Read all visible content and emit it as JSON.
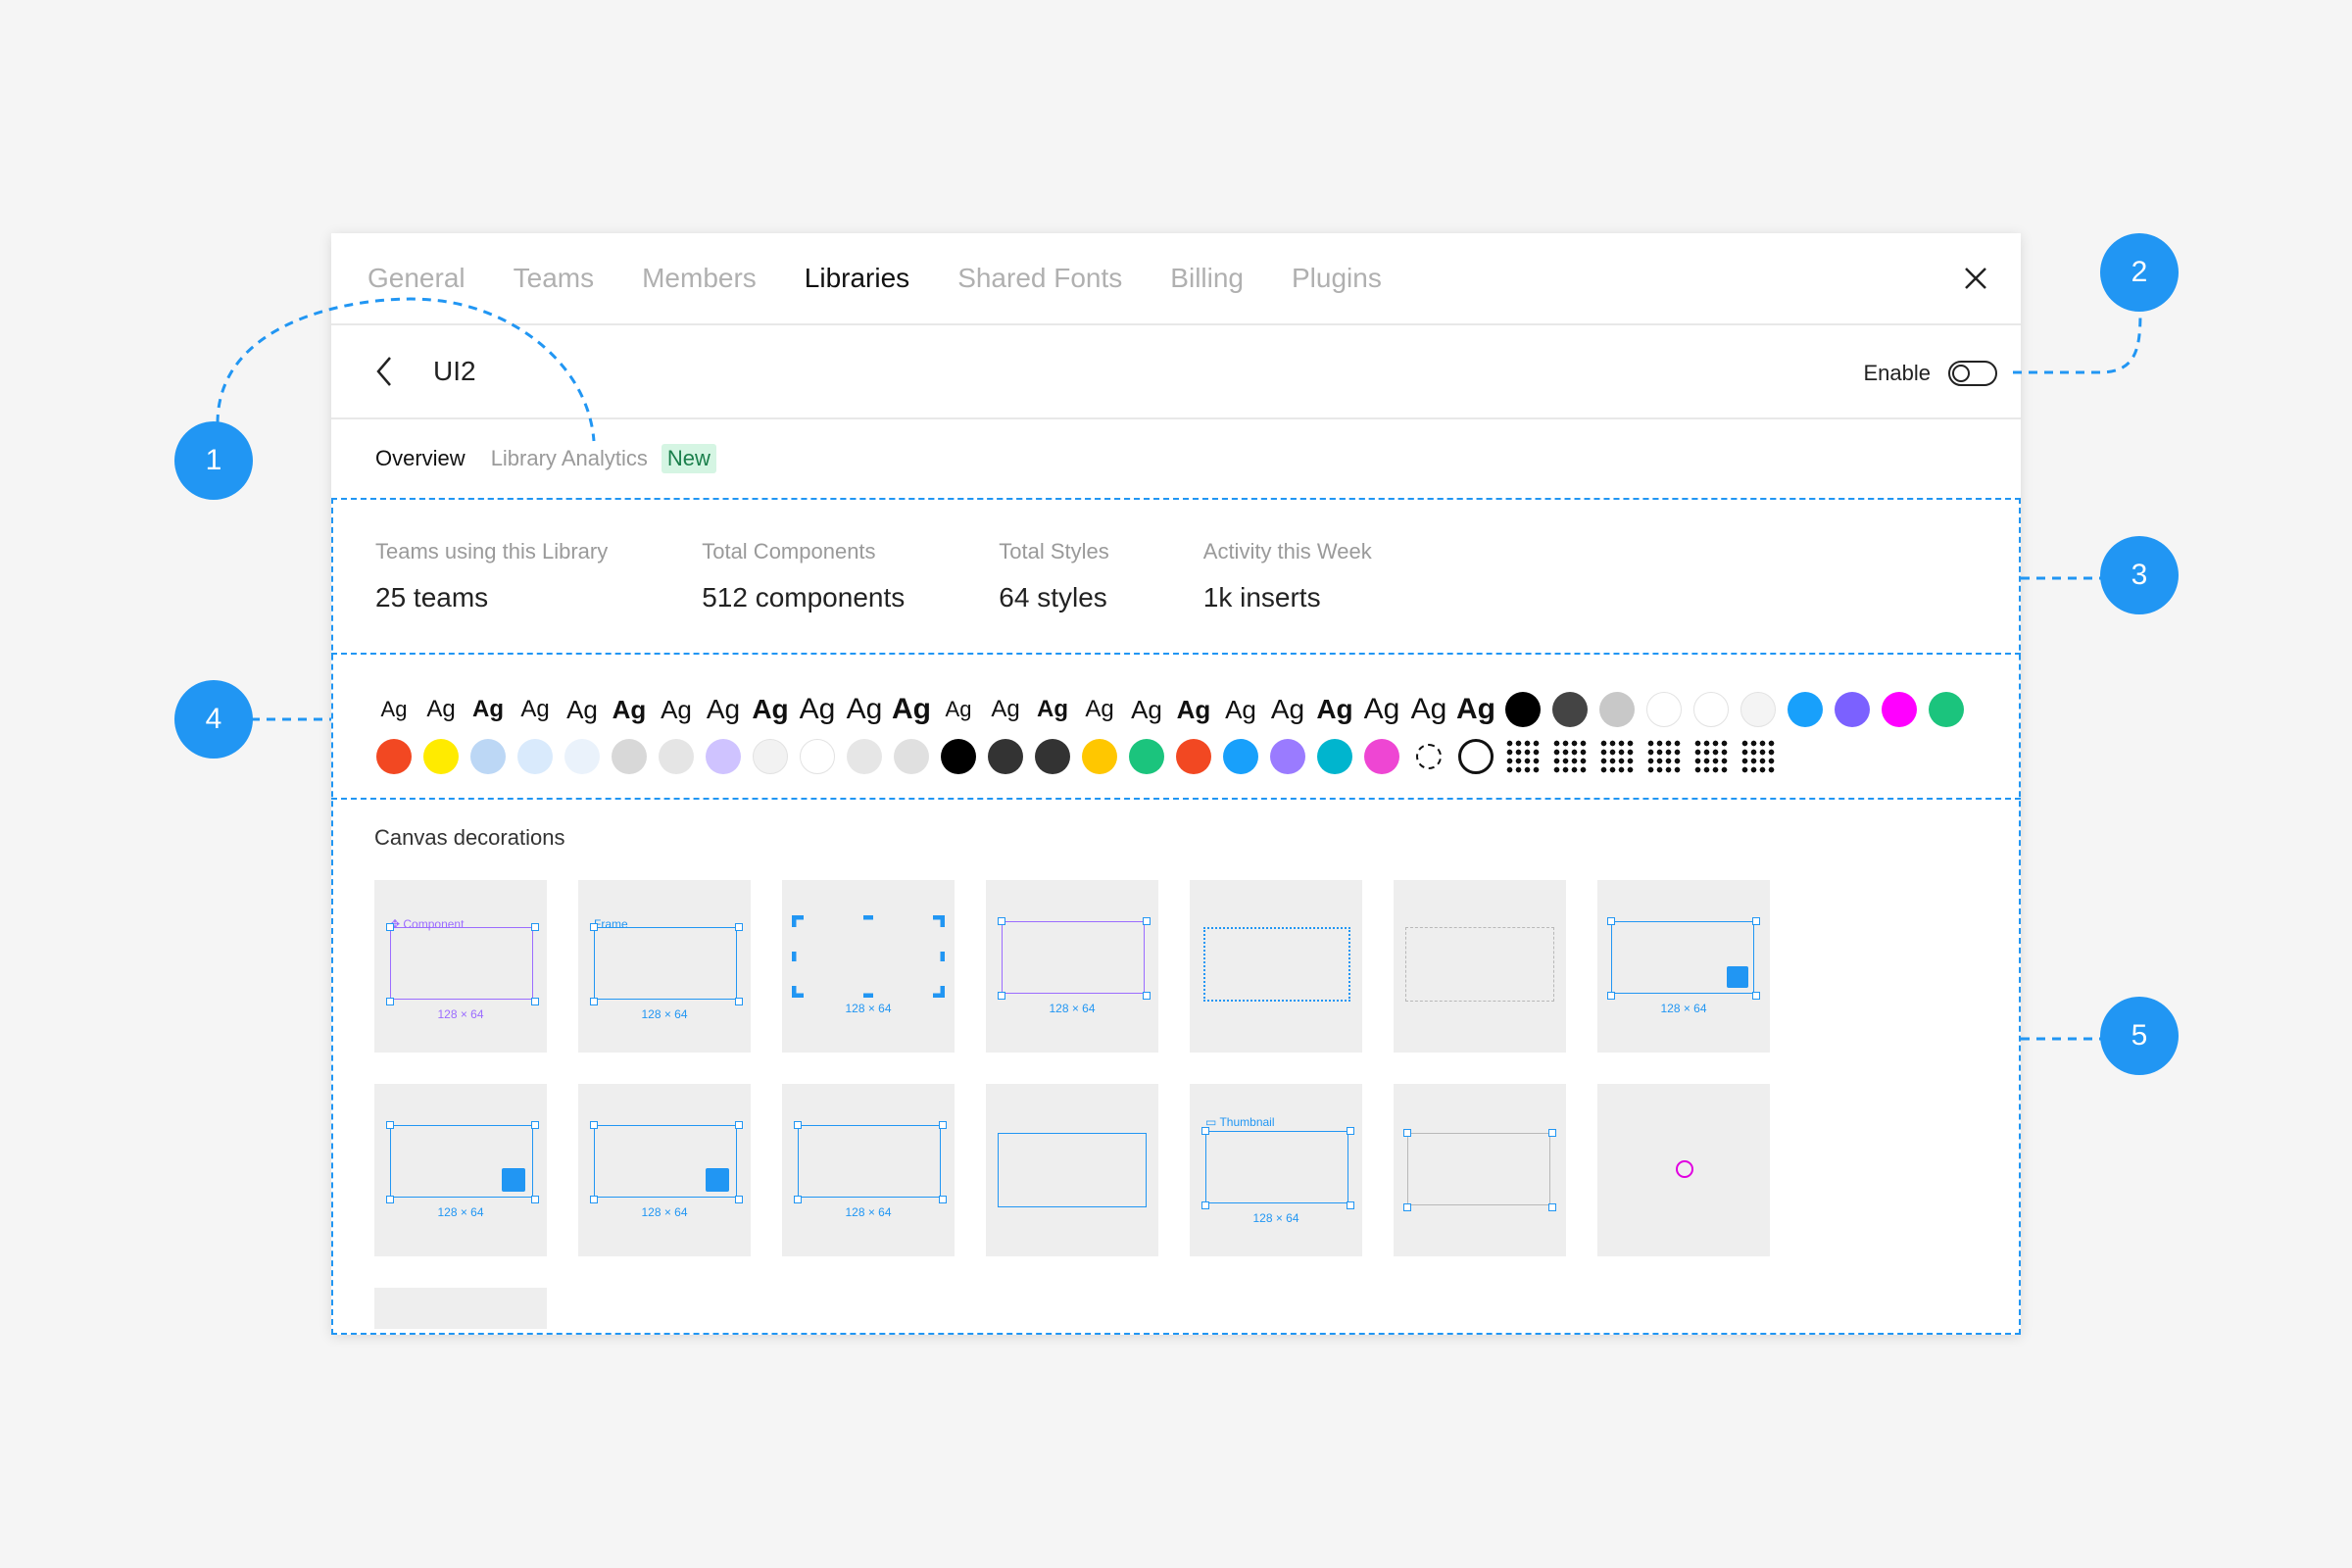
{
  "tabs": [
    "General",
    "Teams",
    "Members",
    "Libraries",
    "Shared Fonts",
    "Billing",
    "Plugins"
  ],
  "active_tab": "Libraries",
  "library": {
    "title": "UI2",
    "enable_label": "Enable",
    "enabled": false
  },
  "subtabs": {
    "overview": "Overview",
    "analytics": "Library Analytics",
    "badge": "New"
  },
  "stats": [
    {
      "label": "Teams using this Library",
      "value": "25 teams"
    },
    {
      "label": "Total Components",
      "value": "512 components"
    },
    {
      "label": "Total Styles",
      "value": "64 styles"
    },
    {
      "label": "Activity this Week",
      "value": "1k inserts"
    }
  ],
  "text_style_sample": "Ag",
  "text_styles_row1_count": 24,
  "colors_row1": [
    "#000000",
    "#444444",
    "#c8c8c8",
    "#ffffff",
    "#ffffff",
    "#f4f4f4",
    "#18a0fb",
    "#7b61ff",
    "#ff00ff",
    "#1bc47d"
  ],
  "colors_row2": [
    "#f24822",
    "#ffeb00",
    "#bcd7f5",
    "#d9eafc",
    "#eaf2fb",
    "#d8d8d8",
    "#e5e5e5",
    "#cfc3ff",
    "#f2f2f2",
    "#ffffff",
    "#e6e6e6",
    "#e0e0e0",
    "#000000",
    "#333333",
    "#333333",
    "#ffc700",
    "#1bc47d",
    "#f24822",
    "#18a0fb",
    "#9a7bff",
    "#00b5ce",
    "#ee46d3"
  ],
  "grid_icon_count": 6,
  "canvas": {
    "title": "Canvas decorations",
    "dimension_label": "128 × 64",
    "component_label": "Component",
    "frame_label": "Frame",
    "thumbnail_label": "Thumbnail"
  },
  "callouts": [
    "1",
    "2",
    "3",
    "4",
    "5"
  ],
  "colors": {
    "accent": "#2196f3",
    "component": "#9b6cff"
  }
}
